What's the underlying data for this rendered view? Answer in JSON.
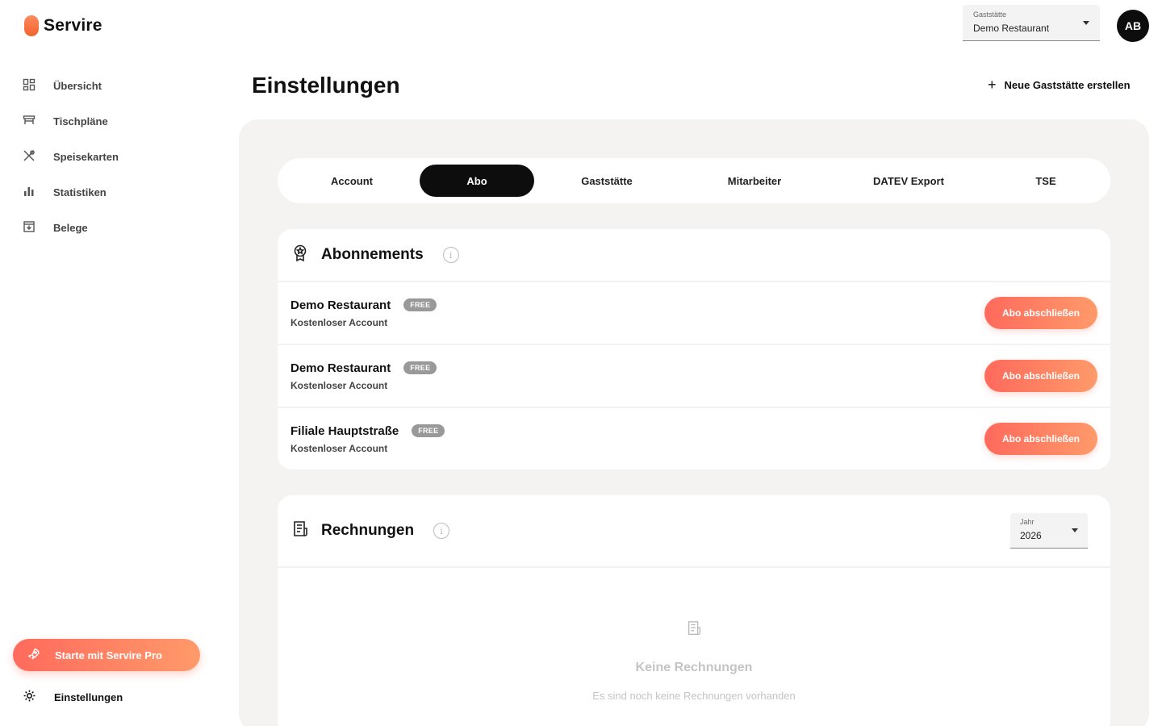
{
  "app": {
    "name": "Servire"
  },
  "sidebar": {
    "items": [
      {
        "label": "Übersicht",
        "icon": "dashboard-icon"
      },
      {
        "label": "Tischpläne",
        "icon": "table-icon"
      },
      {
        "label": "Speisekarten",
        "icon": "cutlery-icon"
      },
      {
        "label": "Statistiken",
        "icon": "bar-chart-icon"
      },
      {
        "label": "Belege",
        "icon": "receipt-download-icon"
      }
    ],
    "pro_button": "Starte mit Servire Pro",
    "settings": "Einstellungen"
  },
  "topbar": {
    "restaurant_select": {
      "label": "Gaststätte",
      "value": "Demo Restaurant"
    },
    "avatar_initials": "AB"
  },
  "page": {
    "title": "Einstellungen",
    "new_button": "Neue Gaststätte erstellen"
  },
  "tabs": [
    {
      "label": "Account",
      "active": false
    },
    {
      "label": "Abo",
      "active": true
    },
    {
      "label": "Gaststätte",
      "active": false
    },
    {
      "label": "Mitarbeiter",
      "active": false
    },
    {
      "label": "DATEV Export",
      "active": false
    },
    {
      "label": "TSE",
      "active": false
    }
  ],
  "subscriptions": {
    "title": "Abonnements",
    "items": [
      {
        "name": "Demo Restaurant",
        "badge": "FREE",
        "plan": "Kostenloser Account",
        "button": "Abo abschließen"
      },
      {
        "name": "Demo Restaurant",
        "badge": "FREE",
        "plan": "Kostenloser Account",
        "button": "Abo abschließen"
      },
      {
        "name": "Filiale Hauptstraße",
        "badge": "FREE",
        "plan": "Kostenloser Account",
        "button": "Abo abschließen"
      }
    ]
  },
  "invoices": {
    "title": "Rechnungen",
    "year_select": {
      "label": "Jahr",
      "value": "2026"
    },
    "empty_title": "Keine Rechnungen",
    "empty_subtitle": "Es sind noch keine Rechnungen vorhanden"
  },
  "colors": {
    "accent_start": "#ff6a5c",
    "accent_end": "#ff9a6a",
    "dark": "#0d0d0d",
    "panel_bg": "#f4f3f2"
  }
}
